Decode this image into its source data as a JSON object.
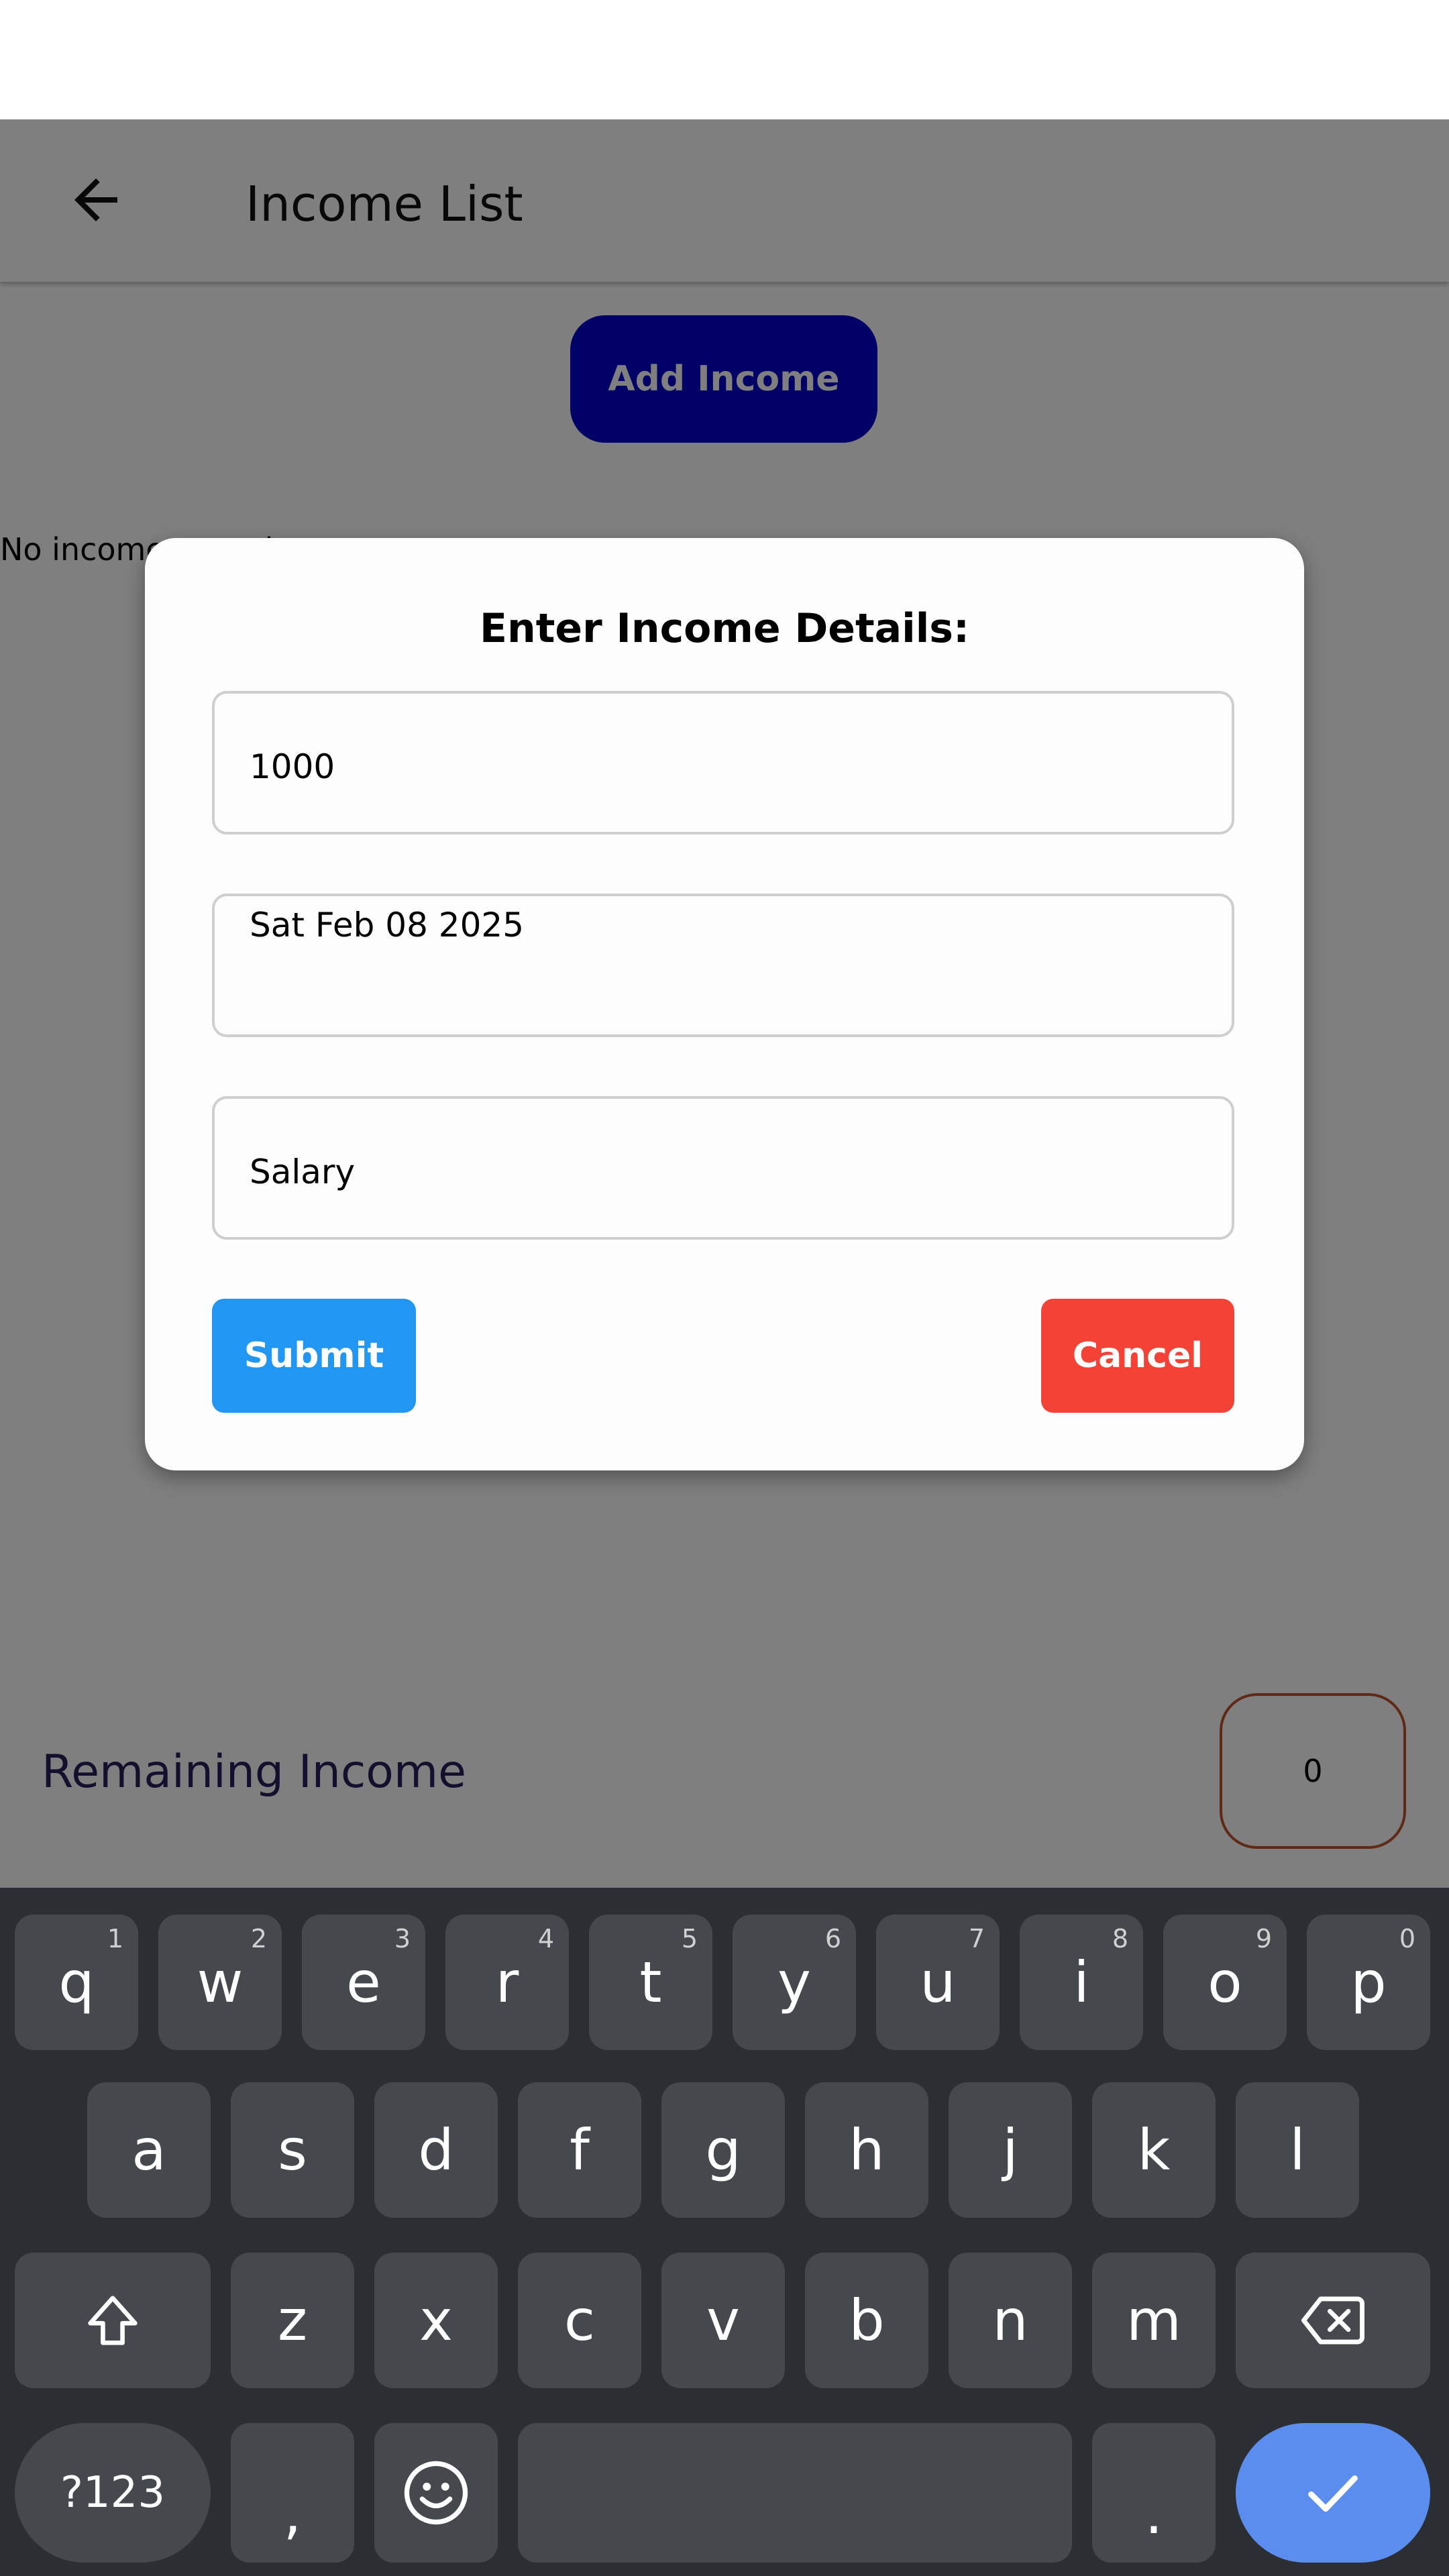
{
  "app_bar": {
    "title": "Income List"
  },
  "add_income_label": "Add Income",
  "empty_message": "No income records",
  "bottom_bar": {
    "remaining_label": "Remaining Income",
    "remaining_value": "0"
  },
  "dialog": {
    "title": "Enter Income Details:",
    "amount_value": "1000",
    "date_value": "Sat Feb 08 2025",
    "source_value": "Salary",
    "submit_label": "Submit",
    "cancel_label": "Cancel"
  },
  "keyboard": {
    "row1": [
      {
        "label": "q",
        "hint": "1"
      },
      {
        "label": "w",
        "hint": "2"
      },
      {
        "label": "e",
        "hint": "3"
      },
      {
        "label": "r",
        "hint": "4"
      },
      {
        "label": "t",
        "hint": "5"
      },
      {
        "label": "y",
        "hint": "6"
      },
      {
        "label": "u",
        "hint": "7"
      },
      {
        "label": "i",
        "hint": "8"
      },
      {
        "label": "o",
        "hint": "9"
      },
      {
        "label": "p",
        "hint": "0"
      }
    ],
    "row2": [
      "a",
      "s",
      "d",
      "f",
      "g",
      "h",
      "j",
      "k",
      "l"
    ],
    "row3": [
      "z",
      "x",
      "c",
      "v",
      "b",
      "n",
      "m"
    ],
    "symbols_label": "?123",
    "comma_label": ",",
    "period_label": "."
  },
  "colors": {
    "add_income_button": "#0000cc",
    "submit_button": "#2196f3",
    "cancel_button": "#f44336",
    "remaining_box_border": "#c0532c",
    "keyboard_bg": "#2b2f33",
    "key_bg": "#45494d",
    "enter_key": "#5b8def"
  },
  "icons": {
    "back": "arrow-left-icon",
    "shift": "shift-icon",
    "backspace": "backspace-icon",
    "emoji": "emoji-icon",
    "enter": "checkmark-icon"
  }
}
